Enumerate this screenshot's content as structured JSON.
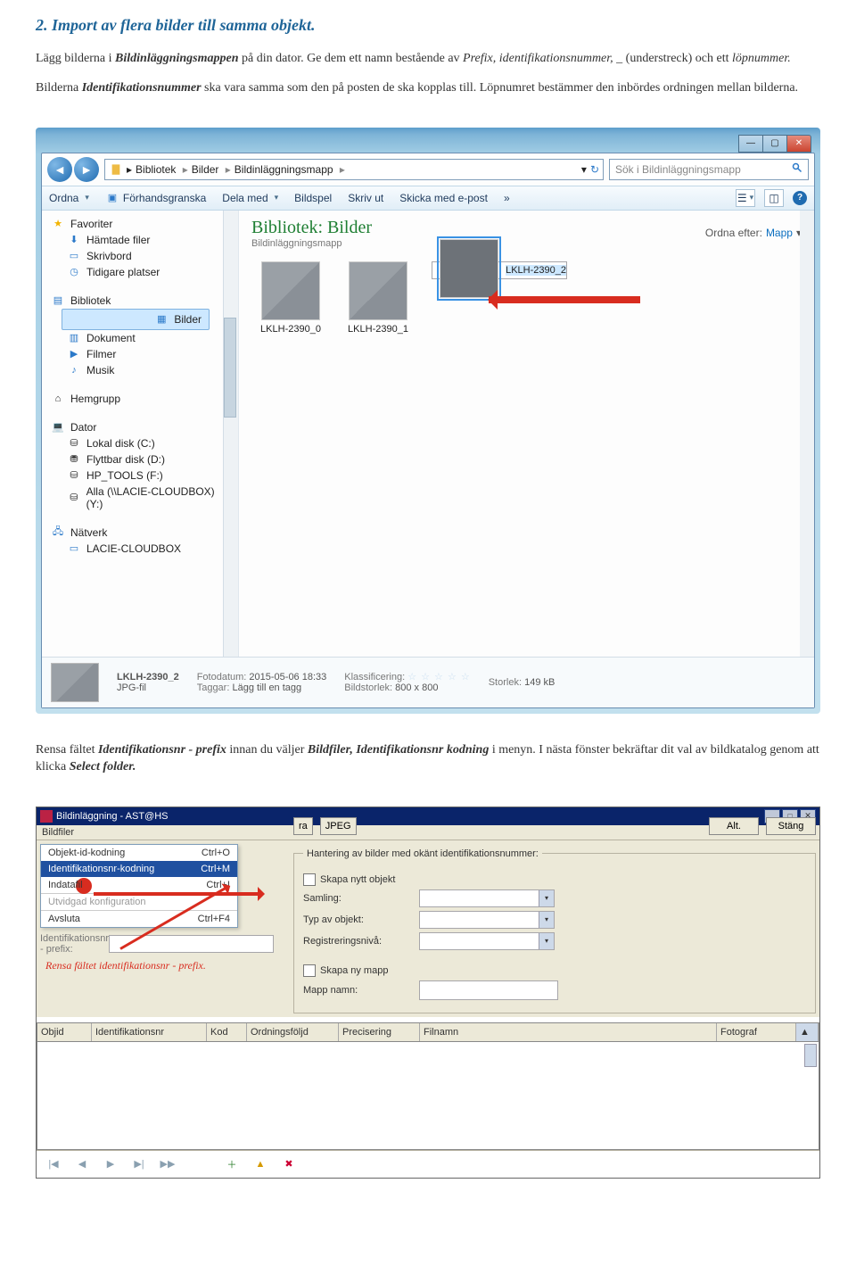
{
  "doc": {
    "heading": "2. Import av flera bilder till samma objekt.",
    "para1_part1": "Lägg bilderna i ",
    "para1_bold": "Bildinläggningsmappen",
    "para1_part2": " på din dator. Ge dem ett namn bestående av ",
    "para1_it1": "Prefix, identifikationsnummer, _",
    "para1_part3": " (understreck) och ett ",
    "para1_it2": "löpnummer.",
    "para2_part1": "Bilderna ",
    "para2_it1": "Identifikationsnummer",
    "para2_part2": " ska vara samma som den på posten de ska kopplas till. Löpnumret bestämmer den inbördes ordningen mellan bilderna.",
    "para3_part1": "Rensa fältet ",
    "para3_it1": "Identifikationsnr - prefix",
    "para3_part2": " innan du väljer ",
    "para3_it2": "Bildfiler, Identifikationsnr kodning",
    "para3_part3": " i menyn. I nästa fönster bekräftar dit val av bildkatalog genom att klicka ",
    "para3_it3": "Select folder."
  },
  "explorer": {
    "breadcrumbs": [
      "Bibliotek",
      "Bilder",
      "Bildinläggningsmapp"
    ],
    "search_placeholder": "Sök i Bildinläggningsmapp",
    "toolbar": {
      "organize": "Ordna",
      "preview": "Förhandsgranska",
      "share": "Dela med",
      "slideshow": "Bildspel",
      "print": "Skriv ut",
      "email": "Skicka med e-post",
      "more": "»"
    },
    "nav": {
      "favorites": "Favoriter",
      "downloads": "Hämtade filer",
      "desktop": "Skrivbord",
      "recent": "Tidigare platser",
      "libraries": "Bibliotek",
      "pictures": "Bilder",
      "documents": "Dokument",
      "videos": "Filmer",
      "music": "Musik",
      "homegroup": "Hemgrupp",
      "computer": "Dator",
      "localdisk": "Lokal disk (C:)",
      "removable": "Flyttbar disk (D:)",
      "hptools": "HP_TOOLS (F:)",
      "alla": "Alla (\\\\LACIE-CLOUDBOX) (Y:)",
      "network": "Nätverk",
      "lacie": "LACIE-CLOUDBOX"
    },
    "lib": {
      "title_a": "Bibliotek:",
      "title_b": "Bilder",
      "sub": "Bildinläggningsmapp",
      "arrange_label": "Ordna efter:",
      "arrange_value": "Mapp"
    },
    "thumbs": [
      {
        "label": "LKLH-2390_0"
      },
      {
        "label": "LKLH-2390_1"
      },
      {
        "label": "LKLH-2390_2"
      }
    ],
    "details": {
      "name": "LKLH-2390_2",
      "type": "JPG-fil",
      "photo_date_k": "Fotodatum:",
      "photo_date_v": "2015-05-06 18:33",
      "tags_k": "Taggar:",
      "tags_v": "Lägg till en tagg",
      "rating_k": "Klassificering:",
      "dim_k": "Bildstorlek:",
      "dim_v": "800 x 800",
      "size_k": "Storlek:",
      "size_v": "149 kB"
    }
  },
  "app": {
    "title": "Bildinläggning - AST@HS",
    "menu": "Bildfiler",
    "items": {
      "objektid": "Objekt-id-kodning",
      "objektid_s": "Ctrl+O",
      "identnr": "Identifikationsnr-kodning",
      "identnr_s": "Ctrl+M",
      "indatafil": "Indatafil",
      "indatafil_s": "Ctrl+I",
      "utv": "Utvidgad konfiguration",
      "avsluta": "Avsluta",
      "avsluta_s": "Ctrl+F4"
    },
    "jpeg": "JPEG",
    "ra": "ra",
    "alt_btn": "Alt.",
    "close_btn": "Stäng",
    "ident_prefix_label": "Identifikationsnr - prefix:",
    "hint": "Rensa fältet identifikationsnr - prefix.",
    "fieldset": {
      "legend": "Hantering av bilder med okänt identifikationsnummer:",
      "create": "Skapa nytt objekt",
      "samling": "Samling:",
      "typ": "Typ av objekt:",
      "regniva": "Registreringsnivå:",
      "newfolder": "Skapa ny mapp",
      "mappnamn": "Mapp namn:"
    },
    "grid": {
      "objid": "Objid",
      "ident": "Identifikationsnr",
      "kod": "Kod",
      "ord": "Ordningsföljd",
      "prec": "Precisering",
      "fil": "Filnamn",
      "fot": "Fotograf"
    },
    "pager": {
      "first": "|◀",
      "prev": "◀",
      "next": "▶",
      "last": "▶|",
      "play": "▶▶",
      "plus": "＋",
      "up": "▲",
      "del": "✖"
    }
  }
}
